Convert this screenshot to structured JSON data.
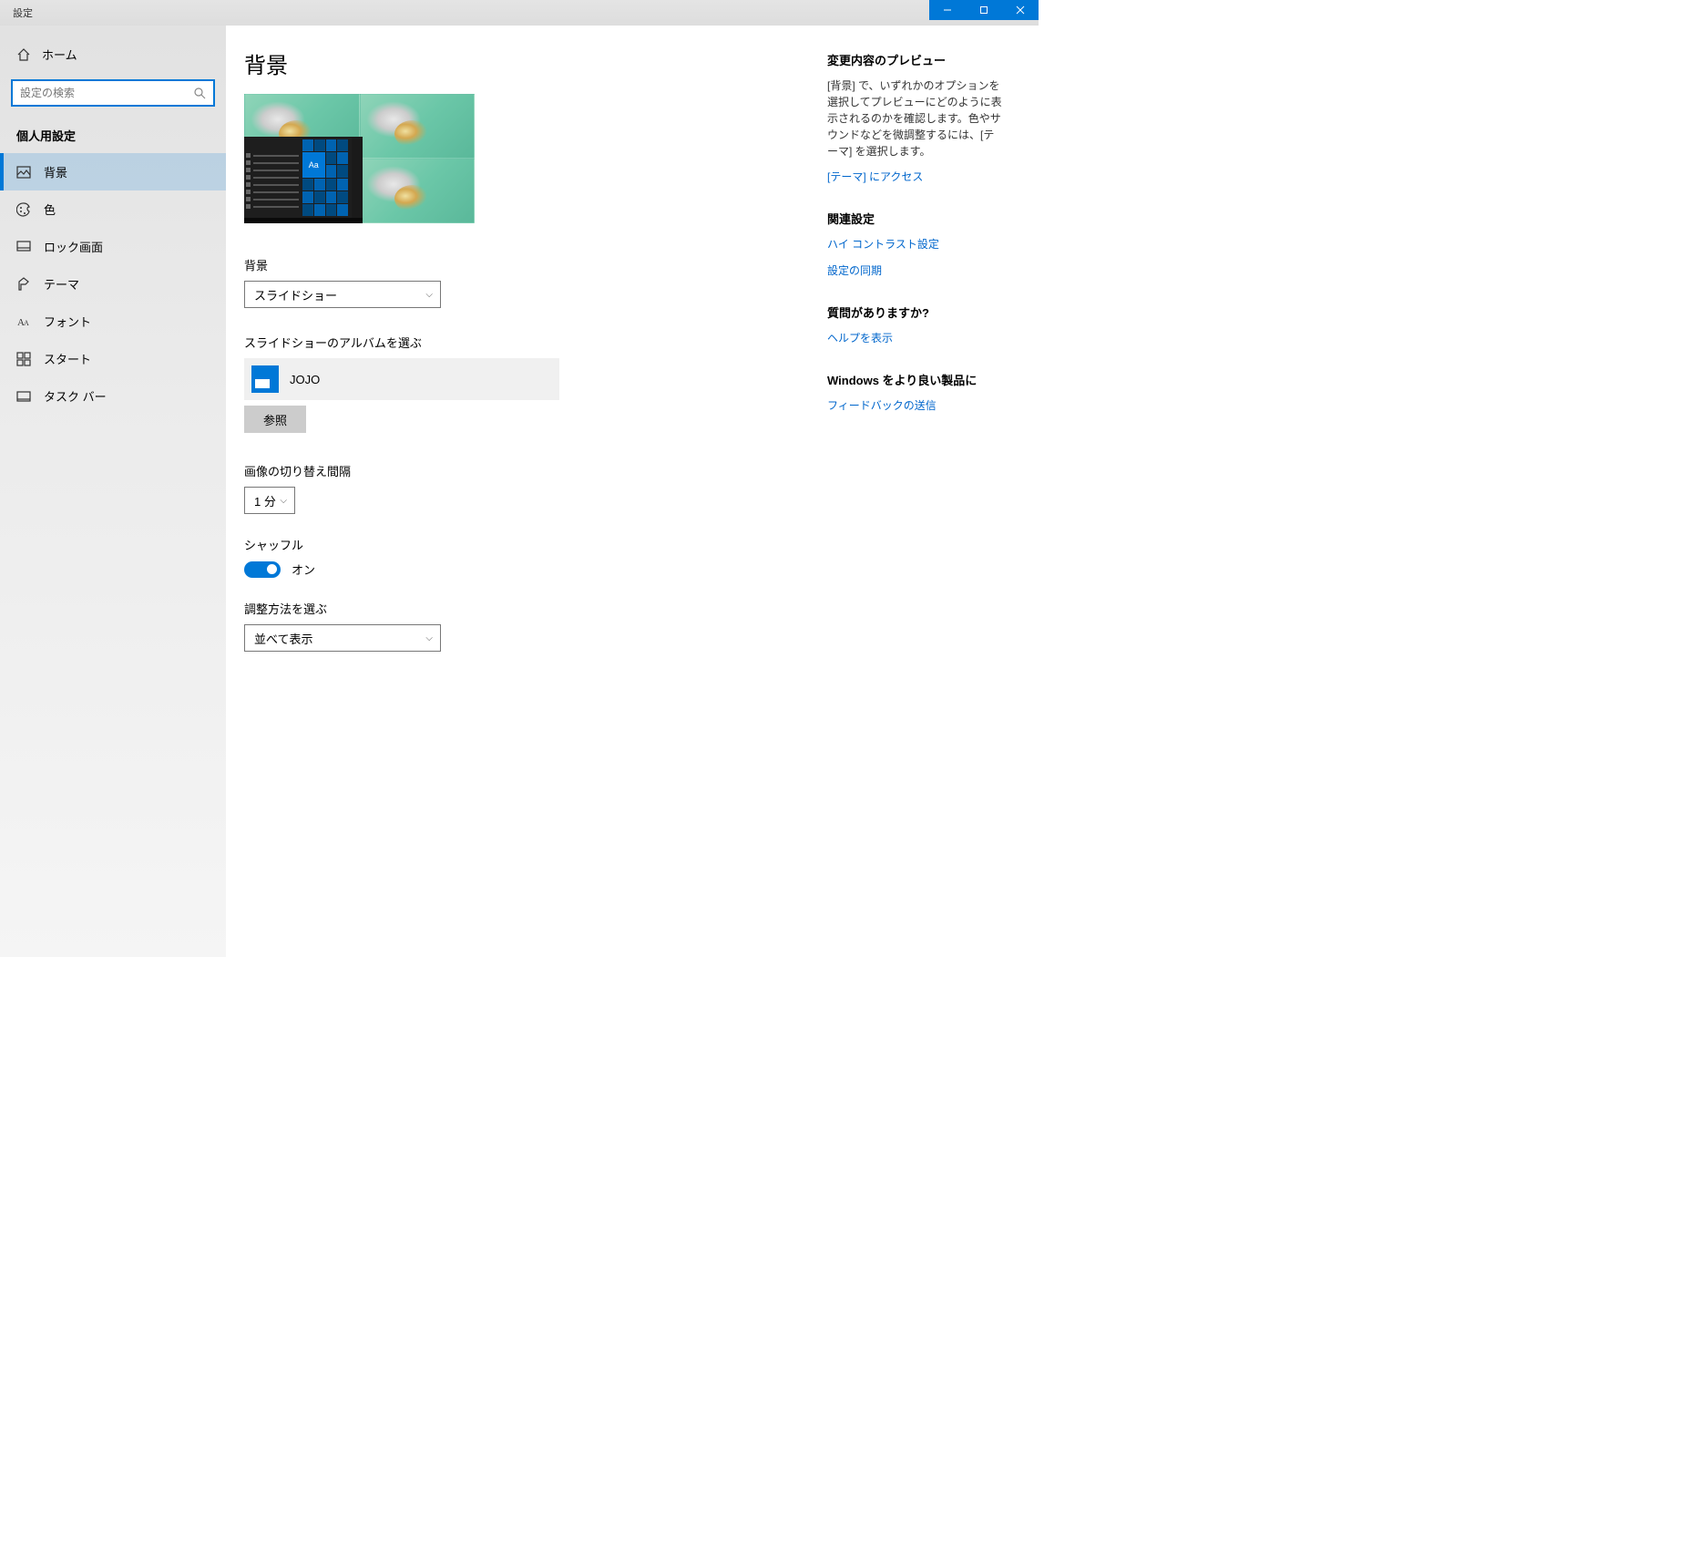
{
  "titlebar": {
    "title": "設定"
  },
  "sidebar": {
    "home": "ホーム",
    "searchPlaceholder": "設定の検索",
    "sectionHeader": "個人用設定",
    "items": [
      {
        "label": "背景"
      },
      {
        "label": "色"
      },
      {
        "label": "ロック画面"
      },
      {
        "label": "テーマ"
      },
      {
        "label": "フォント"
      },
      {
        "label": "スタート"
      },
      {
        "label": "タスク バー"
      }
    ]
  },
  "page": {
    "title": "背景",
    "previewSampleText": "Aa",
    "backgroundLabel": "背景",
    "backgroundValue": "スライドショー",
    "albumLabel": "スライドショーのアルバムを選ぶ",
    "albumName": "JOJO",
    "browseLabel": "参照",
    "intervalLabel": "画像の切り替え間隔",
    "intervalValue": "1 分",
    "shuffleLabel": "シャッフル",
    "shuffleState": "オン",
    "fitLabel": "調整方法を選ぶ",
    "fitValue": "並べて表示"
  },
  "right": {
    "s1": {
      "heading": "変更内容のプレビュー",
      "body": "[背景] で、いずれかのオプションを選択してプレビューにどのように表示されるのかを確認します。色やサウンドなどを微調整するには、[テーマ] を選択します。",
      "link": "[テーマ] にアクセス"
    },
    "s2": {
      "heading": "関連設定",
      "link1": "ハイ コントラスト設定",
      "link2": "設定の同期"
    },
    "s3": {
      "heading": "質問がありますか?",
      "link": "ヘルプを表示"
    },
    "s4": {
      "heading": "Windows をより良い製品に",
      "link": "フィードバックの送信"
    }
  }
}
